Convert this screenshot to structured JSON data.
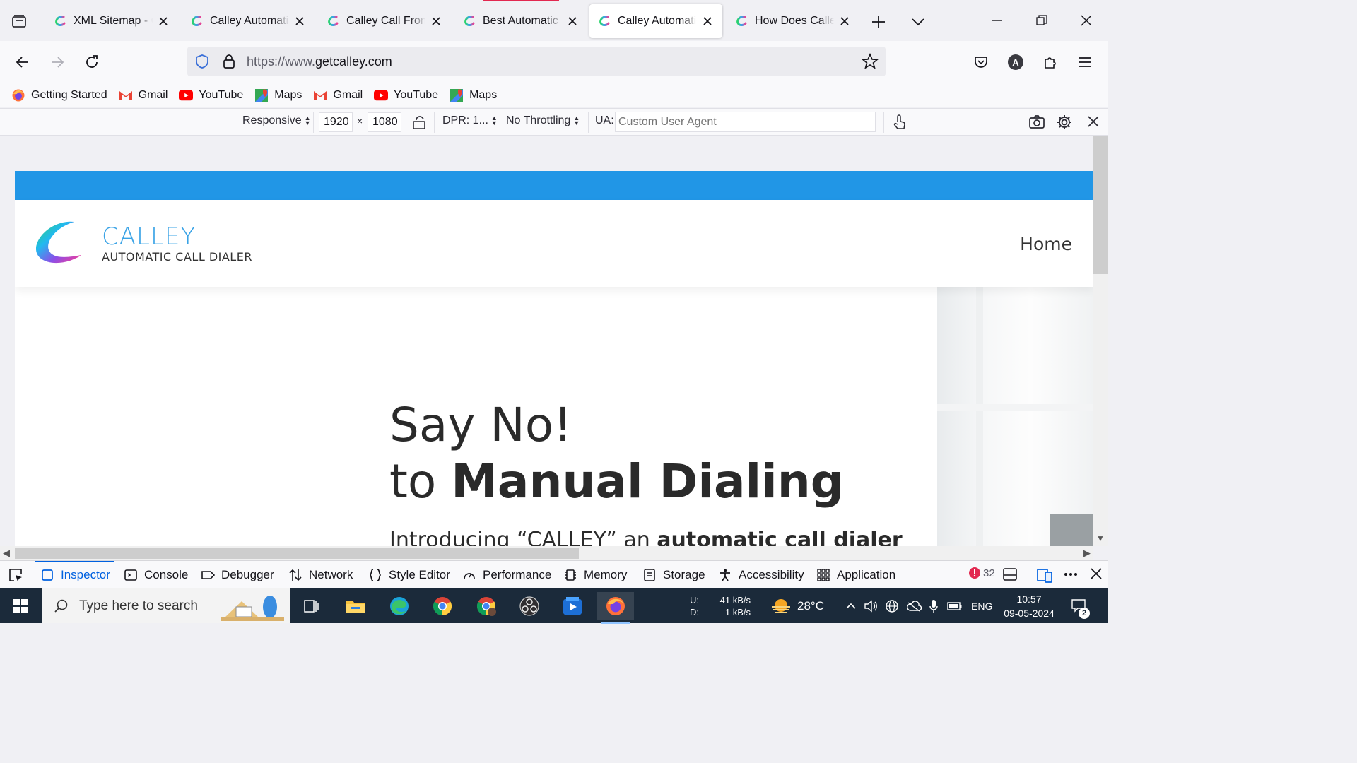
{
  "browser": {
    "tabs": [
      {
        "title": "XML Sitemap - C",
        "active": false
      },
      {
        "title": "Calley Automatic",
        "active": false
      },
      {
        "title": "Calley Call From",
        "active": false
      },
      {
        "title": "Best Automatic C",
        "active": false
      },
      {
        "title": "Calley Automatic",
        "active": true
      },
      {
        "title": "How Does Calley",
        "active": false
      }
    ],
    "url_prefix": "https://www.",
    "url_domain": "getcalley.com",
    "avatar_letter": "A",
    "bookmarks": [
      {
        "label": "Getting Started",
        "icon": "firefox-icon"
      },
      {
        "label": "Gmail",
        "icon": "gmail-icon"
      },
      {
        "label": "YouTube",
        "icon": "youtube-icon"
      },
      {
        "label": "Maps",
        "icon": "maps-icon"
      },
      {
        "label": "Gmail",
        "icon": "gmail-icon"
      },
      {
        "label": "YouTube",
        "icon": "youtube-icon"
      },
      {
        "label": "Maps",
        "icon": "maps-icon"
      }
    ]
  },
  "rdm": {
    "device": "Responsive",
    "width": "1920",
    "height": "1080",
    "times": "×",
    "dpr": "DPR: 1...",
    "throttling": "No Throttling",
    "ua_label": "UA:",
    "ua_placeholder": "Custom User Agent"
  },
  "site": {
    "brand_name": "CALLEY",
    "brand_tagline": "AUTOMATIC CALL DIALER",
    "nav_home": "Home",
    "hero_line1": "Say No!",
    "hero_line2_prefix": "to ",
    "hero_line2_bold": "Manual Dialing",
    "hero_sub_prefix": "Introducing “CALLEY” an ",
    "hero_sub_bold": "automatic call dialer",
    "colors": {
      "topbar": "#2196e6",
      "brand": "#3aa3e6"
    }
  },
  "devtools": {
    "tabs": [
      {
        "label": "Inspector",
        "icon": "inspector-icon",
        "active": true
      },
      {
        "label": "Console",
        "icon": "console-icon"
      },
      {
        "label": "Debugger",
        "icon": "debugger-icon"
      },
      {
        "label": "Network",
        "icon": "network-icon"
      },
      {
        "label": "Style Editor",
        "icon": "style-editor-icon"
      },
      {
        "label": "Performance",
        "icon": "performance-icon"
      },
      {
        "label": "Memory",
        "icon": "memory-icon"
      },
      {
        "label": "Storage",
        "icon": "storage-icon"
      },
      {
        "label": "Accessibility",
        "icon": "accessibility-icon"
      },
      {
        "label": "Application",
        "icon": "application-icon"
      }
    ],
    "error_count": "32"
  },
  "taskbar": {
    "search_placeholder": "Type here to search",
    "net_up_label": "U:",
    "net_down_label": "D:",
    "net_up": "41 kB/s",
    "net_down": "1 kB/s",
    "temperature": "28°C",
    "language": "ENG",
    "time": "10:57",
    "date": "09-05-2024",
    "notifications": "2"
  }
}
